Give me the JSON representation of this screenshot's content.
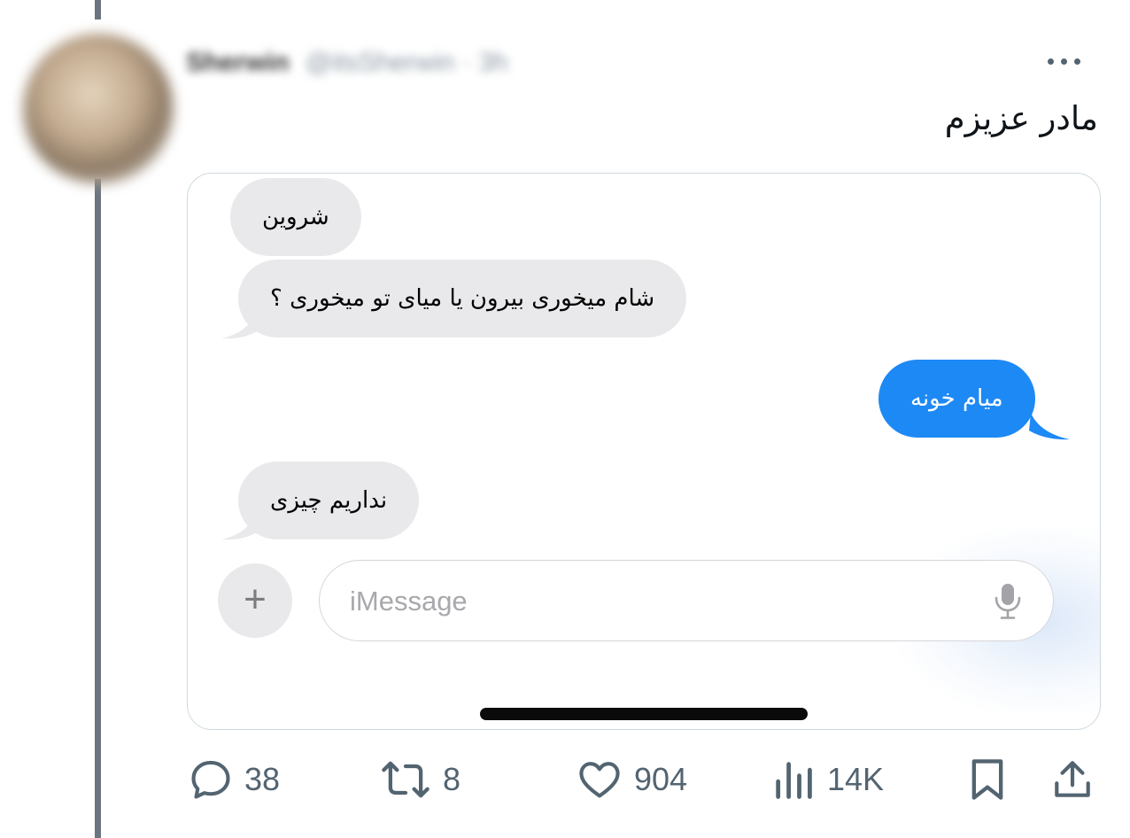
{
  "tweet": {
    "author_name": "Sherwin",
    "author_handle": "@itsSherwin · 3h",
    "text": "مادر عزیزم"
  },
  "card": {
    "messages": [
      {
        "direction": "incoming",
        "text": "شروین"
      },
      {
        "direction": "incoming",
        "text": "شام میخوری بیرون یا میای تو میخوری ؟"
      },
      {
        "direction": "outgoing",
        "text": "میام خونه"
      },
      {
        "direction": "incoming",
        "text": "نداریم چیزی"
      }
    ],
    "input": {
      "placeholder": "iMessage",
      "value": ""
    },
    "plus_label": "+",
    "icons": {
      "plus": "plus-icon",
      "mic": "microphone-icon"
    },
    "colors": {
      "incoming_bubble": "#e9e9eb",
      "outgoing_bubble": "#1d89f5"
    }
  },
  "actions": {
    "reply_count": "38",
    "retweet_count": "8",
    "like_count": "904",
    "view_count": "14K",
    "icons": [
      "reply-icon",
      "retweet-icon",
      "like-icon",
      "views-icon",
      "bookmark-icon",
      "share-icon"
    ]
  }
}
